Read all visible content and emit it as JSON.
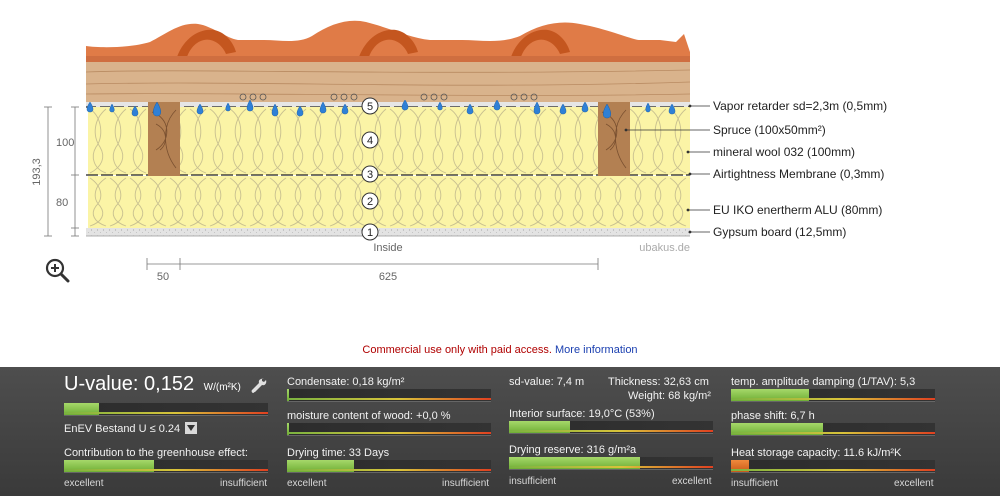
{
  "diagram": {
    "numbers": [
      "1",
      "2",
      "3",
      "4",
      "5"
    ],
    "dim_labels": {
      "total": "193,3",
      "upper": "100",
      "lower": "80",
      "spacing_small": "50",
      "spacing_large": "625"
    },
    "inside_label": "Inside",
    "watermark": "ubakus.de",
    "layer_labels": [
      "Vapor retarder sd=2,3m (0,5mm)",
      "Spruce (100x50mm²)",
      "mineral wool 032 (100mm)",
      "Airtightness Membrane (0,3mm)",
      "EU IKO enertherm ALU (80mm)",
      "Gypsum board (12,5mm)"
    ]
  },
  "notice": {
    "text": "Commercial use only with paid access.",
    "link": "More information"
  },
  "panel": {
    "u_value": {
      "label": "U-value:",
      "value": "0,152",
      "unit": "W/(m²K)",
      "fraction": 0.17
    },
    "enev": {
      "label": "EnEV Bestand U ≤ 0.24"
    },
    "greenhouse": {
      "label": "Contribution to the greenhouse effect:",
      "fraction": 0.44
    },
    "condensate": {
      "label": "Condensate: 0,18 kg/m²",
      "fraction": 0.01
    },
    "moisture": {
      "label": "moisture content of wood: +0,0 %",
      "fraction": 0.01
    },
    "drying_time": {
      "label": "Drying time: 33 Days",
      "fraction": 0.33
    },
    "sd_value": {
      "label": "sd-value: 7,4 m"
    },
    "thickness": {
      "label": "Thickness: 32,63 cm"
    },
    "weight": {
      "label": "Weight: 68 kg/m²"
    },
    "interior_surface": {
      "label": "Interior surface: 19,0°C (53%)",
      "fraction": 0.3
    },
    "drying_reserve": {
      "label": "Drying reserve: 316 g/m²a",
      "fraction": 0.64
    },
    "temp_amp": {
      "label": "temp. amplitude damping (1/TAV): 5,3",
      "fraction": 0.38
    },
    "phase_shift": {
      "label": "phase shift: 6,7 h",
      "fraction": 0.45
    },
    "heat_storage": {
      "label": "Heat storage capacity: 11.6 kJ/m²K",
      "fraction": 0.09
    },
    "scale": {
      "excellent": "excellent",
      "insufficient": "insufficient"
    }
  }
}
